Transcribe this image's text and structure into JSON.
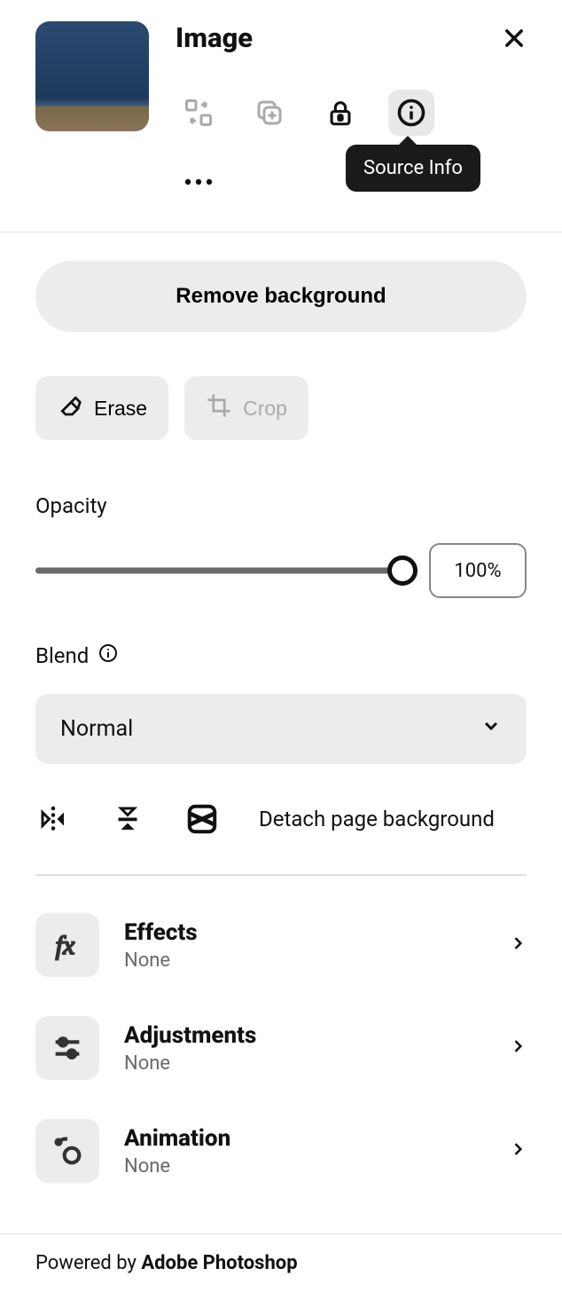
{
  "header": {
    "title": "Image"
  },
  "tooltip": "Source Info",
  "actions": {
    "remove_bg": "Remove background",
    "erase": "Erase",
    "crop": "Crop"
  },
  "opacity": {
    "label": "Opacity",
    "value": "100%"
  },
  "blend": {
    "label": "Blend",
    "value": "Normal"
  },
  "detach": "Detach page background",
  "sections": [
    {
      "title": "Effects",
      "sub": "None"
    },
    {
      "title": "Adjustments",
      "sub": "None"
    },
    {
      "title": "Animation",
      "sub": "None"
    }
  ],
  "footer": {
    "prefix": "Powered by ",
    "brand": "Adobe Photoshop"
  }
}
